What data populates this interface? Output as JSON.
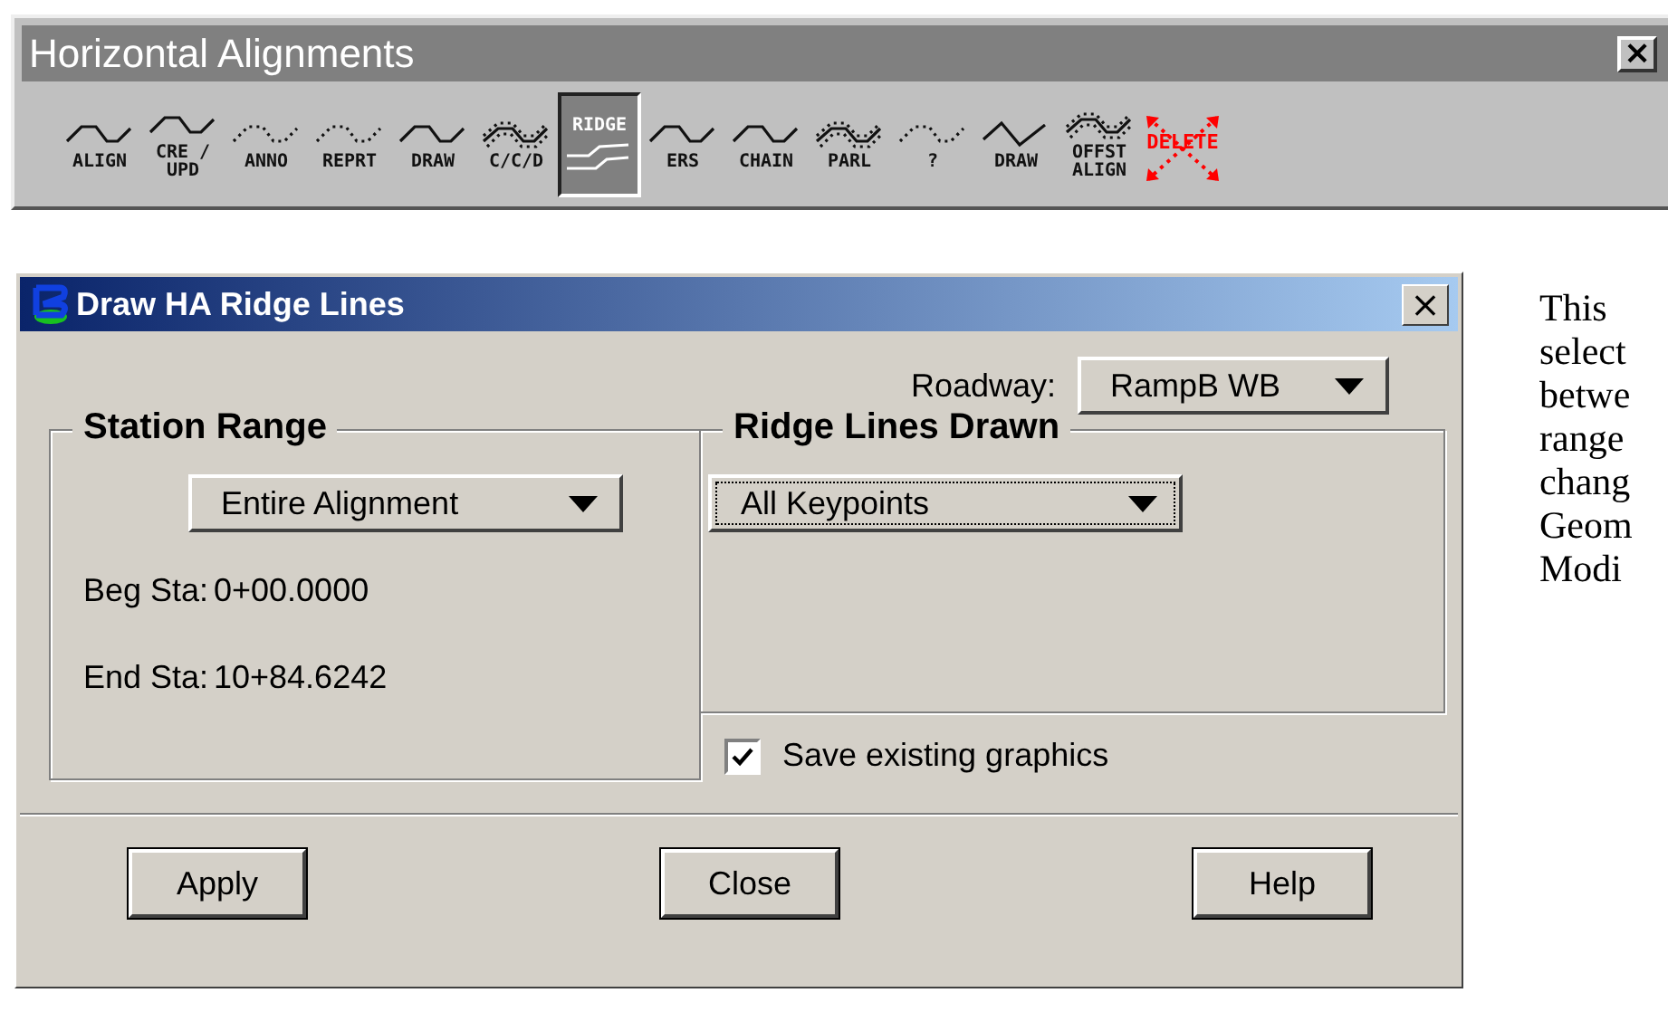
{
  "toolbar": {
    "title": "Horizontal Alignments",
    "close": "×",
    "tools": [
      {
        "label": "ALIGN",
        "kind": "curve",
        "selected": false
      },
      {
        "label": "CRE /\nUPD",
        "kind": "curve",
        "selected": false
      },
      {
        "label": "ANNO",
        "kind": "dotted",
        "selected": false
      },
      {
        "label": "REPRT",
        "kind": "dotted",
        "selected": false
      },
      {
        "label": "DRAW",
        "kind": "curve",
        "selected": false
      },
      {
        "label": "C/C/D",
        "kind": "parallel",
        "selected": false
      },
      {
        "label": "RIDGE",
        "kind": "ridge",
        "selected": true
      },
      {
        "label": "ERS",
        "kind": "curve",
        "selected": false
      },
      {
        "label": "CHAIN",
        "kind": "curve",
        "selected": false
      },
      {
        "label": "PARL",
        "kind": "parallel",
        "selected": false
      },
      {
        "label": "?",
        "kind": "dotted",
        "selected": false
      },
      {
        "label": "DRAW",
        "kind": "vee",
        "selected": false
      },
      {
        "label": "OFFST\nALIGN",
        "kind": "parallel",
        "selected": false
      },
      {
        "label": "DELETE",
        "kind": "delete",
        "selected": false
      }
    ]
  },
  "dialog": {
    "title": "Draw HA Ridge Lines",
    "close": "×",
    "roadway": {
      "label": "Roadway:",
      "value": "RampB WB"
    },
    "station_range": {
      "title": "Station Range",
      "dropdown": "Entire Alignment",
      "rows": [
        {
          "label": "Beg Sta:",
          "value": "0+00.0000"
        },
        {
          "label": "End Sta:",
          "value": "10+84.6242"
        }
      ]
    },
    "ridge_lines": {
      "title": "Ridge Lines Drawn",
      "dropdown": "All Keypoints"
    },
    "save_graphics": {
      "label": "Save existing graphics",
      "checked": true
    },
    "buttons": [
      "Apply",
      "Close",
      "Help"
    ]
  },
  "side_text": [
    "This",
    "select",
    "betwe",
    "range",
    "chang",
    "Geom",
    "Modi"
  ]
}
